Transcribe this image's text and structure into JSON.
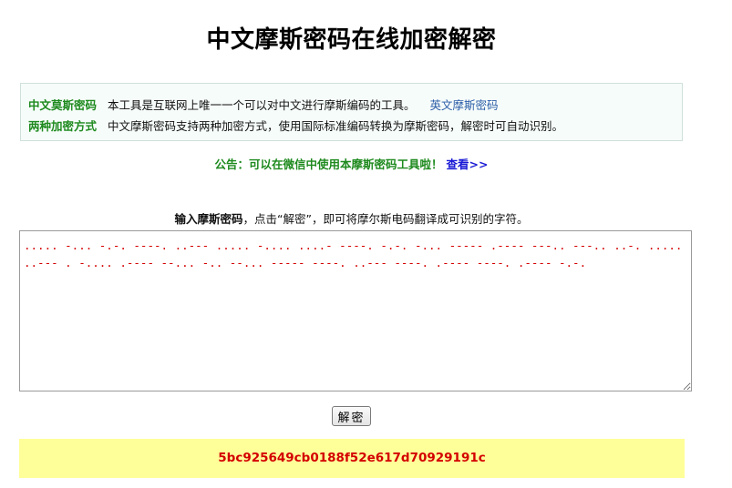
{
  "page": {
    "title": "中文摩斯密码在线加密解密"
  },
  "info": {
    "row1_label": "中文莫斯密码",
    "row1_text": "本工具是互联网上唯一一个可以对中文进行摩斯编码的工具。",
    "row1_link": "英文摩斯密码",
    "row2_label": "两种加密方式",
    "row2_text": "中文摩斯密码支持两种加密方式，使用国际标准编码转换为摩斯密码，解密时可自动识别。"
  },
  "notice": {
    "text": "公告：可以在微信中使用本摩斯密码工具啦！",
    "link": "查看>>"
  },
  "instruction": {
    "bold": "输入摩斯密码",
    "rest": "，点击“解密”，即可将摩尔斯电码翻译成可识别的字符。"
  },
  "input": {
    "value": "..... -... -.-. ----. ..--- ..... -.... ....- ----. -.-. -... ----- .---- ---.. ---.. ..-. ..... ..--- . -.... .---- --... -.. --... ----- ----. ..--- ----. .---- ----. .---- -.-."
  },
  "button": {
    "decrypt_label": "解密"
  },
  "result": {
    "value": "5bc925649cb0188f52e617d70929191c"
  },
  "colors": {
    "label_green": "#1e8a1e",
    "link_blue": "#2b5da8",
    "morse_red": "#d40000",
    "result_bg": "#ffff99"
  }
}
